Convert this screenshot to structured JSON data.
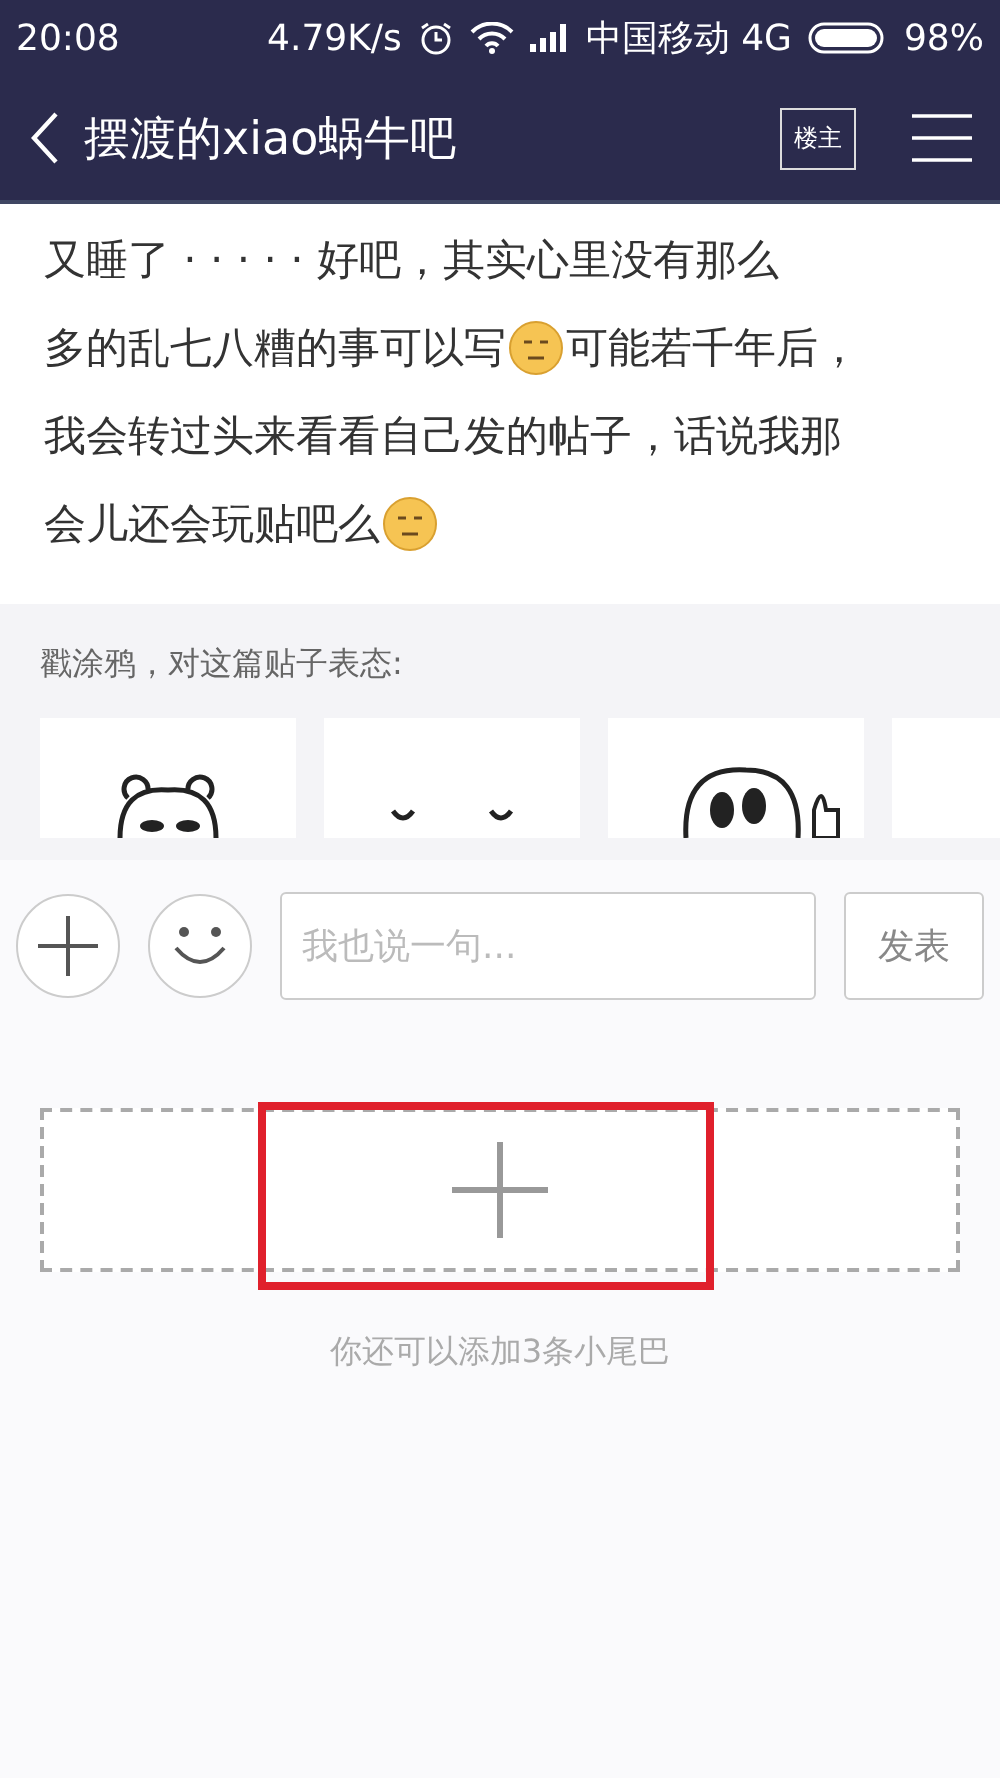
{
  "status_bar": {
    "time": "20:08",
    "speed": "4.79K/s",
    "carrier": "中国移动 4G",
    "battery": "98%"
  },
  "header": {
    "title": "摆渡的xiao蜗牛吧",
    "owner_button": "楼主"
  },
  "post": {
    "lines": [
      {
        "segments": [
          {
            "kind": "text",
            "text": "又睡了 · · · · · 好吧，其实心里没有那么"
          }
        ]
      },
      {
        "segments": [
          {
            "kind": "text",
            "text": "多的乱七八糟的事可以写"
          },
          {
            "kind": "emoji"
          },
          {
            "kind": "text",
            "text": " 可能若千年后，"
          }
        ]
      },
      {
        "segments": [
          {
            "kind": "text",
            "text": "我会转过头来看看自己发的帖子，话说我那"
          }
        ]
      },
      {
        "segments": [
          {
            "kind": "text",
            "text": "会儿还会玩贴吧么"
          },
          {
            "kind": "emoji"
          }
        ]
      }
    ]
  },
  "doodle": {
    "label": "戳涂鸦，对这篇贴子表态:",
    "stickers": [
      {
        "kind": "bear"
      },
      {
        "kind": "eyes"
      },
      {
        "kind": "blob"
      },
      {
        "kind": "blank"
      }
    ]
  },
  "reply_bar": {
    "placeholder": "我也说一句...",
    "send": "发表"
  },
  "tail": {
    "hint": "你还可以添加3条小尾巴",
    "highlighted": true
  }
}
